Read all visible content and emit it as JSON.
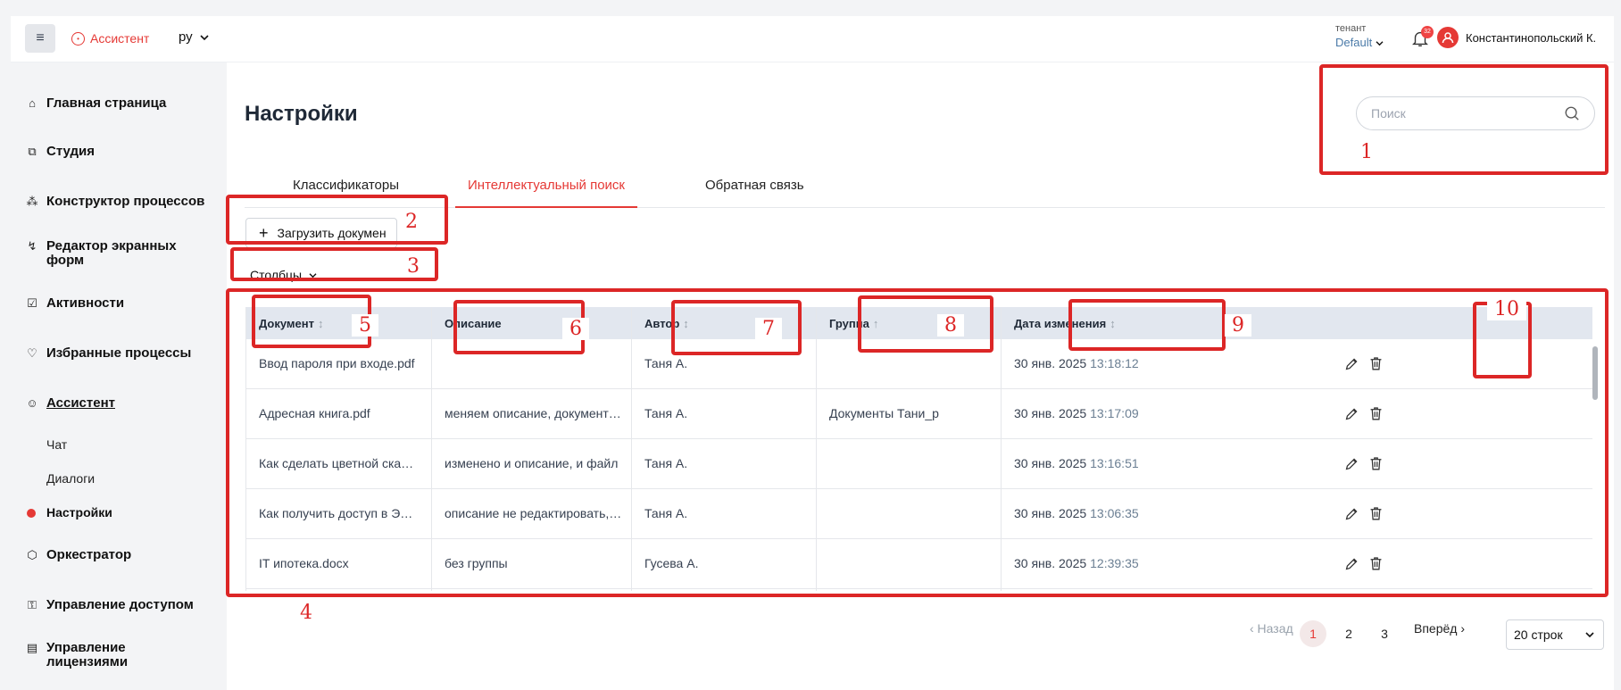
{
  "header": {
    "menu_icon": "hamburger-icon",
    "brand": "Ассистент",
    "lang": "ру",
    "tenant_label": "тенант",
    "tenant_value": "Default",
    "notifications_count": "32",
    "user_name": "Константинопольский К."
  },
  "sidebar": {
    "items": [
      {
        "label": "Главная страница",
        "icon": "home-icon"
      },
      {
        "label": "Студия",
        "icon": "studio-icon"
      },
      {
        "label": "Конструктор процессов",
        "icon": "process-icon"
      },
      {
        "label": "Редактор экранных форм",
        "icon": "forms-icon"
      },
      {
        "label": "Активности",
        "icon": "activities-icon"
      },
      {
        "label": "Избранные процессы",
        "icon": "heart-icon"
      },
      {
        "label": "Ассистент",
        "icon": "assistant-icon"
      },
      {
        "label": "Оркестратор",
        "icon": "orchestrator-icon"
      },
      {
        "label": "Управление доступом",
        "icon": "lock-icon"
      },
      {
        "label": "Управление лицензиями",
        "icon": "license-icon"
      }
    ],
    "sub": [
      "Чат",
      "Диалоги",
      "Настройки"
    ]
  },
  "main": {
    "title": "Настройки",
    "search_placeholder": "Поиск",
    "tabs": [
      "Классификаторы",
      "Интеллектуальный поиск",
      "Обратная связь"
    ],
    "upload_label": "Загрузить докумен",
    "columns_label": "Столбцы"
  },
  "table": {
    "headers": [
      "Документ",
      "Описание",
      "Автор",
      "Группа",
      "Дата изменения"
    ],
    "rows": [
      {
        "doc": "Ввод пароля при входе.pdf",
        "desc": "",
        "author": "Таня А.",
        "group": "",
        "date": "30 янв. 2025",
        "time": "13:18:12"
      },
      {
        "doc": "Адресная книга.pdf",
        "desc": "меняем описание, документ не …",
        "author": "Таня А.",
        "group": "Документы Тани_р",
        "date": "30 янв. 2025",
        "time": "13:17:09"
      },
      {
        "doc": "Как сделать цветной сканоб…",
        "desc": "изменено и описание, и файл",
        "author": "Таня А.",
        "group": "",
        "date": "30 янв. 2025",
        "time": "13:16:51"
      },
      {
        "doc": "Как получить доступ в ЭТРА…",
        "desc": "описание не редактировать, об…",
        "author": "Таня А.",
        "group": "",
        "date": "30 янв. 2025",
        "time": "13:06:35"
      },
      {
        "doc": "IT ипотека.docx",
        "desc": "без группы",
        "author": "Гусева А.",
        "group": "",
        "date": "30 янв. 2025",
        "time": "12:39:35"
      }
    ]
  },
  "pagination": {
    "prev": "‹ Назад",
    "pages": [
      "1",
      "2",
      "3"
    ],
    "next": "Вперёд ›",
    "page_size": "20 строк"
  },
  "annotations": [
    "1",
    "2",
    "3",
    "4",
    "5",
    "6",
    "7",
    "8",
    "9",
    "10"
  ],
  "colors": {
    "accent": "#e53935",
    "annotation": "#dc2626",
    "header_bg": "#e2e7ef"
  }
}
